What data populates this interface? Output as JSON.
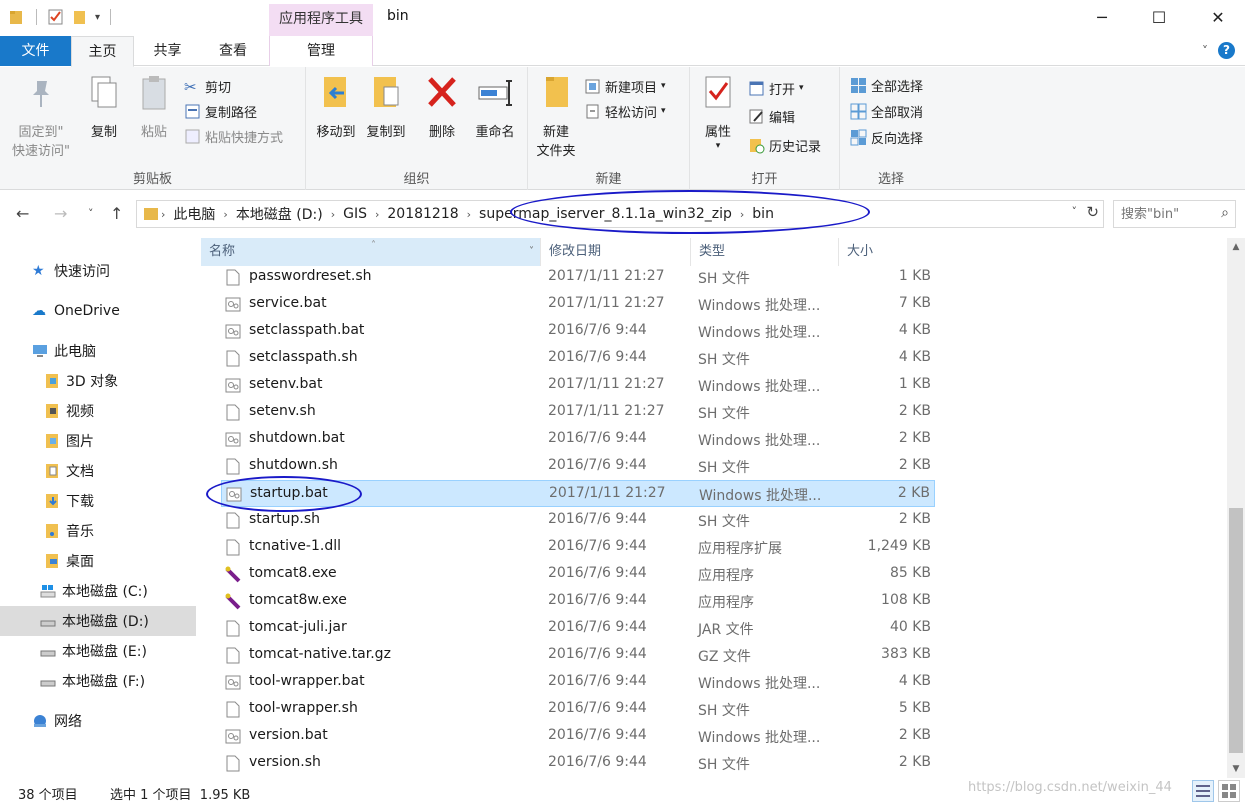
{
  "window": {
    "title": "bin",
    "context_tab_header": "应用程序工具",
    "minimize_glyph": "─",
    "maximize_glyph": "☐",
    "close_glyph": "✕"
  },
  "tabs": {
    "file": "文件",
    "home": "主页",
    "share": "共享",
    "view": "查看",
    "manage": "管理"
  },
  "ribbon": {
    "clipboard": {
      "label": "剪贴板",
      "pin_line1": "固定到\"",
      "pin_line2": "快速访问\"",
      "copy": "复制",
      "paste": "粘贴",
      "cut": "剪切",
      "copy_path": "复制路径",
      "paste_shortcut": "粘贴快捷方式"
    },
    "organize": {
      "label": "组织",
      "move_to": "移动到",
      "copy_to": "复制到",
      "delete": "删除",
      "rename": "重命名"
    },
    "new": {
      "label": "新建",
      "new_folder_line1": "新建",
      "new_folder_line2": "文件夹",
      "new_item": "新建项目",
      "easy_access": "轻松访问"
    },
    "open": {
      "label": "打开",
      "properties": "属性",
      "open": "打开",
      "edit": "编辑",
      "history": "历史记录"
    },
    "select": {
      "label": "选择",
      "select_all": "全部选择",
      "select_none": "全部取消",
      "invert": "反向选择"
    }
  },
  "address": {
    "crumbs": [
      "此电脑",
      "本地磁盘 (D:)",
      "GIS",
      "20181218",
      "supermap_iserver_8.1.1a_win32_zip",
      "bin"
    ],
    "search_placeholder": "搜索\"bin\""
  },
  "nav": {
    "items": [
      {
        "label": "快速访问",
        "icon": "star-icon"
      },
      {
        "label": "OneDrive",
        "icon": "cloud-icon"
      },
      {
        "label": "此电脑",
        "icon": "computer-icon"
      },
      {
        "label": "3D 对象",
        "icon": "folder-icon"
      },
      {
        "label": "视频",
        "icon": "folder-icon"
      },
      {
        "label": "图片",
        "icon": "folder-icon"
      },
      {
        "label": "文档",
        "icon": "folder-icon"
      },
      {
        "label": "下载",
        "icon": "folder-icon"
      },
      {
        "label": "音乐",
        "icon": "folder-icon"
      },
      {
        "label": "桌面",
        "icon": "folder-icon"
      },
      {
        "label": "本地磁盘 (C:)",
        "icon": "drive-icon"
      },
      {
        "label": "本地磁盘 (D:)",
        "icon": "drive-icon"
      },
      {
        "label": "本地磁盘 (E:)",
        "icon": "drive-icon"
      },
      {
        "label": "本地磁盘 (F:)",
        "icon": "drive-icon"
      },
      {
        "label": "网络",
        "icon": "network-icon"
      }
    ]
  },
  "columns": {
    "name": "名称",
    "date": "修改日期",
    "type": "类型",
    "size": "大小"
  },
  "files": [
    {
      "name": "passwordreset.sh",
      "date": "2017/1/11 21:27",
      "type": "SH 文件",
      "size": "1 KB",
      "icon": "file-icon"
    },
    {
      "name": "service.bat",
      "date": "2017/1/11 21:27",
      "type": "Windows 批处理...",
      "size": "7 KB",
      "icon": "batch-file-icon"
    },
    {
      "name": "setclasspath.bat",
      "date": "2016/7/6 9:44",
      "type": "Windows 批处理...",
      "size": "4 KB",
      "icon": "batch-file-icon"
    },
    {
      "name": "setclasspath.sh",
      "date": "2016/7/6 9:44",
      "type": "SH 文件",
      "size": "4 KB",
      "icon": "file-icon"
    },
    {
      "name": "setenv.bat",
      "date": "2017/1/11 21:27",
      "type": "Windows 批处理...",
      "size": "1 KB",
      "icon": "batch-file-icon"
    },
    {
      "name": "setenv.sh",
      "date": "2017/1/11 21:27",
      "type": "SH 文件",
      "size": "2 KB",
      "icon": "file-icon"
    },
    {
      "name": "shutdown.bat",
      "date": "2016/7/6 9:44",
      "type": "Windows 批处理...",
      "size": "2 KB",
      "icon": "batch-file-icon"
    },
    {
      "name": "shutdown.sh",
      "date": "2016/7/6 9:44",
      "type": "SH 文件",
      "size": "2 KB",
      "icon": "file-icon"
    },
    {
      "name": "startup.bat",
      "date": "2017/1/11 21:27",
      "type": "Windows 批处理...",
      "size": "2 KB",
      "icon": "batch-file-icon",
      "selected": true
    },
    {
      "name": "startup.sh",
      "date": "2016/7/6 9:44",
      "type": "SH 文件",
      "size": "2 KB",
      "icon": "file-icon"
    },
    {
      "name": "tcnative-1.dll",
      "date": "2016/7/6 9:44",
      "type": "应用程序扩展",
      "size": "1,249 KB",
      "icon": "file-icon"
    },
    {
      "name": "tomcat8.exe",
      "date": "2016/7/6 9:44",
      "type": "应用程序",
      "size": "85 KB",
      "icon": "tomcat-exe-icon"
    },
    {
      "name": "tomcat8w.exe",
      "date": "2016/7/6 9:44",
      "type": "应用程序",
      "size": "108 KB",
      "icon": "tomcat-exe-icon"
    },
    {
      "name": "tomcat-juli.jar",
      "date": "2016/7/6 9:44",
      "type": "JAR 文件",
      "size": "40 KB",
      "icon": "file-icon"
    },
    {
      "name": "tomcat-native.tar.gz",
      "date": "2016/7/6 9:44",
      "type": "GZ 文件",
      "size": "383 KB",
      "icon": "file-icon"
    },
    {
      "name": "tool-wrapper.bat",
      "date": "2016/7/6 9:44",
      "type": "Windows 批处理...",
      "size": "4 KB",
      "icon": "batch-file-icon"
    },
    {
      "name": "tool-wrapper.sh",
      "date": "2016/7/6 9:44",
      "type": "SH 文件",
      "size": "5 KB",
      "icon": "file-icon"
    },
    {
      "name": "version.bat",
      "date": "2016/7/6 9:44",
      "type": "Windows 批处理...",
      "size": "2 KB",
      "icon": "batch-file-icon"
    },
    {
      "name": "version.sh",
      "date": "2016/7/6 9:44",
      "type": "SH 文件",
      "size": "2 KB",
      "icon": "file-icon"
    }
  ],
  "status": {
    "item_count": "38 个项目",
    "selection": "选中 1 个项目  1.95 KB",
    "watermark": "https://blog.csdn.net/weixin_44"
  },
  "colors": {
    "accent": "#1979ca",
    "selection": "#cce8ff",
    "annotation": "#1a1ac8",
    "context_tab": "#f3ddf3"
  }
}
